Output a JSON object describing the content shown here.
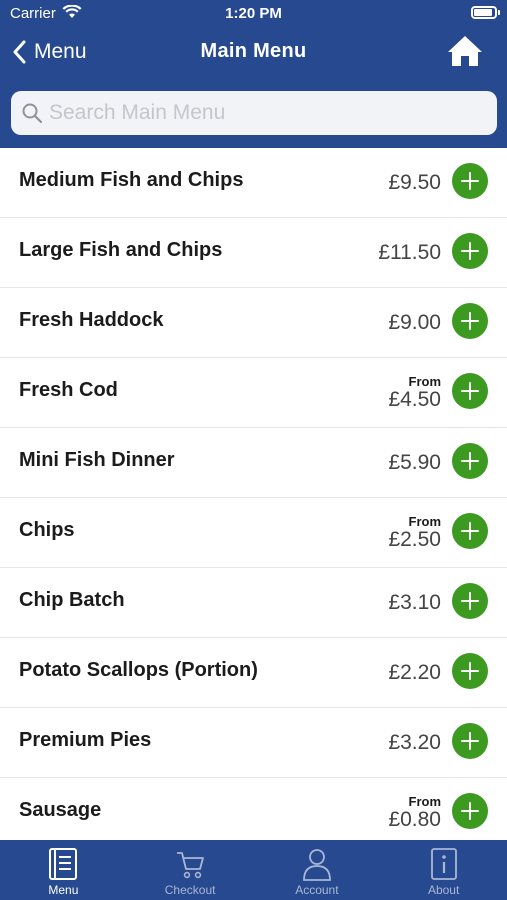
{
  "status_bar": {
    "carrier": "Carrier",
    "time": "1:20 PM"
  },
  "nav": {
    "back_label": "Menu",
    "title": "Main Menu"
  },
  "search": {
    "placeholder": "Search Main Menu",
    "value": ""
  },
  "items": [
    {
      "name": "Medium Fish and Chips",
      "from": "",
      "price": "£9.50"
    },
    {
      "name": "Large Fish and Chips",
      "from": "",
      "price": "£11.50"
    },
    {
      "name": "Fresh Haddock",
      "from": "",
      "price": "£9.00"
    },
    {
      "name": "Fresh Cod",
      "from": "From",
      "price": "£4.50"
    },
    {
      "name": "Mini Fish Dinner",
      "from": "",
      "price": "£5.90"
    },
    {
      "name": "Chips",
      "from": "From",
      "price": "£2.50"
    },
    {
      "name": "Chip Batch",
      "from": "",
      "price": "£3.10"
    },
    {
      "name": "Potato Scallops (Portion)",
      "from": "",
      "price": "£2.20"
    },
    {
      "name": "Premium Pies",
      "from": "",
      "price": "£3.20"
    },
    {
      "name": "Sausage",
      "from": "From",
      "price": "£0.80"
    }
  ],
  "tabs": [
    {
      "label": "Menu",
      "icon": "menu-book-icon",
      "active": true
    },
    {
      "label": "Checkout",
      "icon": "cart-icon",
      "active": false
    },
    {
      "label": "Account",
      "icon": "person-icon",
      "active": false
    },
    {
      "label": "About",
      "icon": "info-icon",
      "active": false
    }
  ],
  "colors": {
    "brand_blue": "#27498f",
    "add_green": "#3c9a21",
    "tab_inactive": "#a9b7d6"
  }
}
